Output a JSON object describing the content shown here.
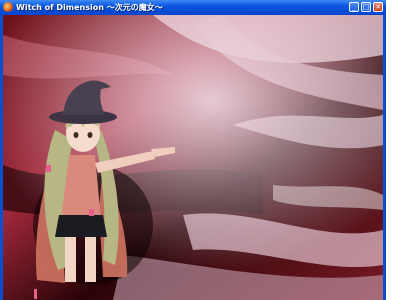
{
  "window": {
    "title": "Witch of Dimension ～次元の魔女～",
    "app_icon": "game-app-icon",
    "buttons": {
      "minimize_icon": "minimize-icon",
      "maximize_icon": "maximize-icon",
      "close_icon": "close-icon"
    }
  },
  "scene": {
    "background": "red-swirl-dimension-backdrop",
    "character": "witch-girl-pointing",
    "colors": {
      "dark_red": "#3a0608",
      "crimson": "#b0283a",
      "pale_pink": "#ecd3dd",
      "hat": "#4a4150",
      "hair": "#b7b685",
      "dress": "#d98a7c"
    }
  }
}
